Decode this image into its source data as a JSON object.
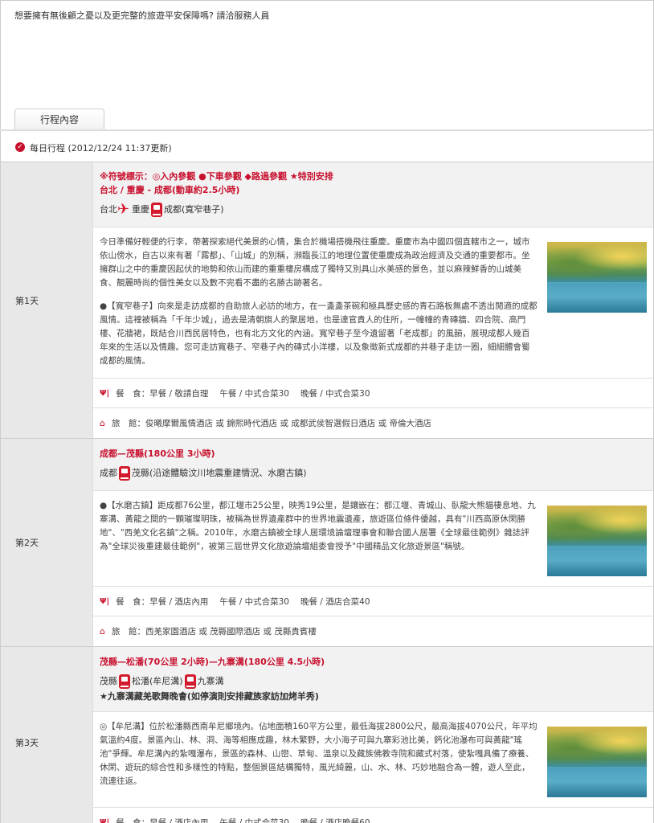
{
  "notice": "想要擁有無後顧之憂以及更完整的旅遊平安保障嗎? 請洽服務人員",
  "tab": "行程內容",
  "daily": {
    "label": "每日行程 (2012/12/24 11:37更新)"
  },
  "days": [
    {
      "label": "第1天",
      "legend": "※符號標示：◎入內參觀 ●下車參觀 ◆路過參觀 ★特別安排",
      "title": "台北 / 重慶 - 成都(動車約2.5小時)",
      "path": [
        "台北",
        "重慶",
        "成都(寬窄巷子)"
      ],
      "paragraphs": [
        "今日準備好輕便的行李，帶著探索絕代美景的心情，集合於機場搭機飛往重慶。重慶市為中國四個直轄市之一，城市依山傍水，自古以來有著「霧都」、「山城」的別稱，瀕臨長江的地理位置使重慶成為政治經濟及交通的重要都市。坐擁群山之中的重慶因起伏的地勢和依山而建的重重樓房構成了獨特又別具山水美感的景色，並以麻辣鮮香的山城美食、靚麗時尚的個性美女以及數不完看不盡的名勝古跡著名。",
        "●【寬窄巷子】向來是走訪成都的自助旅人必訪的地方，在一盞盞茶碗和極具歷史感的青石路板無處不透出閒適的成都風情。這裡被稱為「千年少城」，過去是清朝旗人的聚居地，也是達官貴人的住所，一幢幢的青磚牆、四合院、高門樓、花牆裙，既結合川西民居特色，也有北方文化的內涵。寬窄巷子至今遺留著「老成都」的風韻，展現成都人幾百年來的生活以及情趣。您可走訪寬巷子、窄巷子內的磚式小洋樓，以及象徵新式成都的井巷子走訪一圈，細細體會蜀成都的風情。"
      ],
      "meal": {
        "label": "餐　食：",
        "breakfast": "早餐 / 敬請自理",
        "lunch": "午餐 / 中式合菜30",
        "dinner": "晚餐 / 中式合菜30"
      },
      "hotel": "旅　館：俊曦摩爾風情酒店 或 錦熙時代酒店 或 成都武侯智選假日酒店 或 帝倫大酒店"
    },
    {
      "label": "第2天",
      "title": "成都—茂縣(180公里 3小時)",
      "path": [
        "成都",
        "茂縣(沿途體驗汶川地震重建情況、水磨古鎮)"
      ],
      "paragraphs": [
        "●【水磨古鎮】距成都76公里，都江堰市25公里，映秀19公里，是鑲嵌在：都江堰、青城山、臥龍大熊貓棲息地、九寨溝、黃龍之間的一顆璀璨明珠，被稱為世界遺產群中的世界地震遺產，旅遊區位條件優越，具有\"川西高原休閑勝地\"、\"西羌文化名鎮\"之稱。2010年，水磨古鎮被全球人居環境論壇理事會和聯合國人居署《全球最佳範例》雜誌評為\"全球災後重建最佳範例\"，被第三屆世界文化旅遊論壇組委會授予\"中國精品文化旅遊景區\"稱號。"
      ],
      "meal": {
        "label": "餐　食：",
        "breakfast": "早餐 / 酒店內用",
        "lunch": "午餐 / 中式合菜30",
        "dinner": "晚餐 / 酒店合菜40"
      },
      "hotel": "旅　館：西羌家園酒店 或 茂縣國際酒店 或 茂縣貴賓樓"
    },
    {
      "label": "第3天",
      "title": "茂縣—松潘(70公里 2小時)—九寨溝(180公里 4.5小時)",
      "path": [
        "茂縣",
        "松潘(牟尼溝)",
        "九寨溝"
      ],
      "extra": "★九寨溝藏羌歌舞晚會(如停演則安排藏族家訪加烤羊秀)",
      "paragraphs": [
        "◎【牟尼溝】位於松潘縣西南牟尼鄉境內。佔地面積160平方公里，最低海拔2800公尺，最高海拔4070公尺，年平均氣溫約4度。景區內山、林、洞、海等相應成趣，林木繁野，大小海子可與九寨彩池比美，鈣化池瀑布可與黃龍\"瑤池\"爭輝。牟尼溝內的紮嘎瀑布，景區的森林、山巒、草甸、溫泉以及藏族佛教寺院和藏式村落，使紮嘎具備了療養、休閑、遊玩的綜合性和多樣性的特點，整個景區結構獨特，風光綺麗，山、水、林、巧妙地融合為一體，遊人至此，流連往返。"
      ],
      "meal": {
        "label": "餐　食：",
        "breakfast": "早餐 / 酒店內用",
        "lunch": "午餐 / 中式合菜30",
        "dinner": "晚餐 / 酒店晚餐60"
      }
    }
  ],
  "icons": {
    "check": "check-badge-icon",
    "plane": "plane-icon",
    "train": "train-icon",
    "meal": "fork-knife-icon",
    "hotel": "home-icon"
  },
  "colors": {
    "accent": "#c8102e",
    "route_bg": "#f2f2f2",
    "day_bg": "#e8e8e8"
  }
}
